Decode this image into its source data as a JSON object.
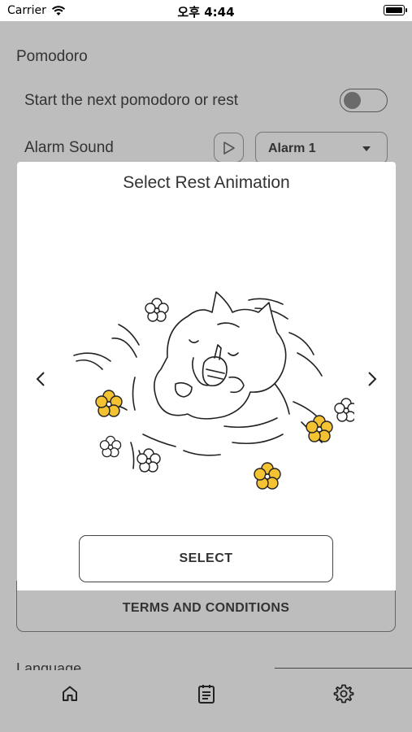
{
  "status_bar": {
    "carrier": "Carrier",
    "time": "오후 4:44"
  },
  "settings": {
    "section_title": "Pomodoro",
    "auto_start_label": "Start the next pomodoro or rest",
    "auto_start_on": false,
    "alarm_sound_label": "Alarm Sound",
    "alarm_sound_value": "Alarm 1",
    "terms_label": "TERMS AND CONDITIONS",
    "language_label": "Language"
  },
  "modal": {
    "title": "Select Rest Animation",
    "select_label": "SELECT",
    "illustration": "sleeping-cat-with-flowers"
  },
  "tab_bar": {
    "icons": [
      "home-icon",
      "calendar-list-icon",
      "settings-gear-icon"
    ],
    "active": "settings"
  },
  "colors": {
    "flower_yellow": "#f5c332",
    "overlay_gray": "#bdbdbd",
    "line": "#222222"
  }
}
